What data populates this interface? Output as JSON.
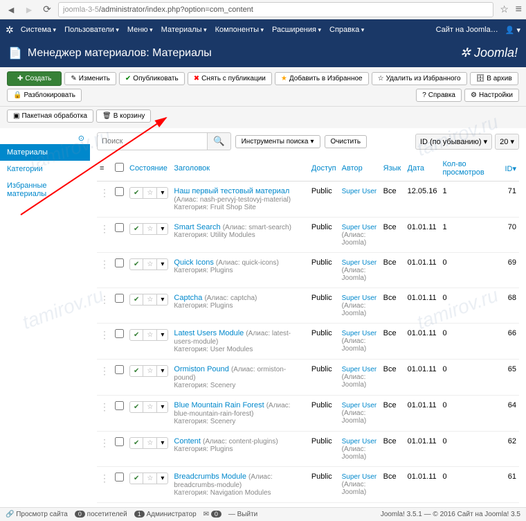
{
  "browser": {
    "url_gray": "joomla-3-5",
    "url_rest": "/administrator/index.php?option=com_content"
  },
  "top_menu": [
    "Система",
    "Пользователи",
    "Меню",
    "Материалы",
    "Компоненты",
    "Расширения",
    "Справка"
  ],
  "top_right": {
    "site": "Сайт на Joomla…",
    "user_icon": "👤"
  },
  "page_title": "Менеджер материалов: Материалы",
  "brand": "Joomla!",
  "toolbar": {
    "create": "Создать",
    "edit": "Изменить",
    "publish": "Опубликовать",
    "unpublish": "Снять с публикации",
    "feature": "Добавить в Избранное",
    "unfeature": "Удалить из Избранного",
    "archive": "В архив",
    "unlock": "Разблокировать",
    "batch": "Пакетная обработка",
    "trash": "В корзину",
    "help": "Справка",
    "options": "Настройки"
  },
  "sidebar": {
    "items": [
      "Материалы",
      "Категории",
      "Избранные материалы"
    ],
    "active": 0
  },
  "search": {
    "placeholder": "Поиск",
    "tools": "Инструменты поиска",
    "clear": "Очистить",
    "sort": "ID (по убыванию)",
    "limit": "20"
  },
  "columns": {
    "state": "Состояние",
    "title": "Заголовок",
    "access": "Доступ",
    "author": "Автор",
    "lang": "Язык",
    "date": "Дата",
    "hits": "Кол-во просмотров",
    "id": "ID"
  },
  "meta_labels": {
    "alias": "Алиас",
    "category": "Категория"
  },
  "rows": [
    {
      "title": "Наш первый тестовый материал",
      "alias": "nash-pervyj-testovyj-material",
      "category": "Fruit Shop Site",
      "access": "Public",
      "author": "Super User",
      "author_meta": "",
      "lang": "Все",
      "date": "12.05.16",
      "hits": "1",
      "id": "71"
    },
    {
      "title": "Smart Search",
      "alias": "smart-search",
      "category": "Utility Modules",
      "access": "Public",
      "author": "Super User",
      "author_meta": "Joomla",
      "lang": "Все",
      "date": "01.01.11",
      "hits": "1",
      "id": "70"
    },
    {
      "title": "Quick Icons",
      "alias": "quick-icons",
      "category": "Plugins",
      "access": "Public",
      "author": "Super User",
      "author_meta": "Joomla",
      "lang": "Все",
      "date": "01.01.11",
      "hits": "0",
      "id": "69"
    },
    {
      "title": "Captcha",
      "alias": "captcha",
      "category": "Plugins",
      "access": "Public",
      "author": "Super User",
      "author_meta": "Joomla",
      "lang": "Все",
      "date": "01.01.11",
      "hits": "0",
      "id": "68"
    },
    {
      "title": "Latest Users Module",
      "alias": "latest-users-module",
      "category": "User Modules",
      "access": "Public",
      "author": "Super User",
      "author_meta": "Joomla",
      "lang": "Все",
      "date": "01.01.11",
      "hits": "0",
      "id": "66"
    },
    {
      "title": "Ormiston Pound",
      "alias": "ormiston-pound",
      "category": "Scenery",
      "access": "Public",
      "author": "Super User",
      "author_meta": "Joomla",
      "lang": "Все",
      "date": "01.01.11",
      "hits": "0",
      "id": "65"
    },
    {
      "title": "Blue Mountain Rain Forest",
      "alias": "blue-mountain-rain-forest",
      "category": "Scenery",
      "access": "Public",
      "author": "Super User",
      "author_meta": "Joomla",
      "lang": "Все",
      "date": "01.01.11",
      "hits": "0",
      "id": "64"
    },
    {
      "title": "Content",
      "alias": "content-plugins",
      "category": "Plugins",
      "access": "Public",
      "author": "Super User",
      "author_meta": "Joomla",
      "lang": "Все",
      "date": "01.01.11",
      "hits": "0",
      "id": "62"
    },
    {
      "title": "Breadcrumbs Module",
      "alias": "breadcrumbs-module",
      "category": "Navigation Modules",
      "access": "Public",
      "author": "Super User",
      "author_meta": "Joomla",
      "lang": "Все",
      "date": "01.01.11",
      "hits": "0",
      "id": "61"
    }
  ],
  "footer": {
    "preview": "Просмотр сайта",
    "visitors": "посетителей",
    "admin": "Администратор",
    "msg_count": "0",
    "logout": "Выйти",
    "version": "Joomla! 3.5.1",
    "copyright": "© 2016 Сайт на Joomla! 3.5"
  },
  "watermark": "tamirov.ru"
}
